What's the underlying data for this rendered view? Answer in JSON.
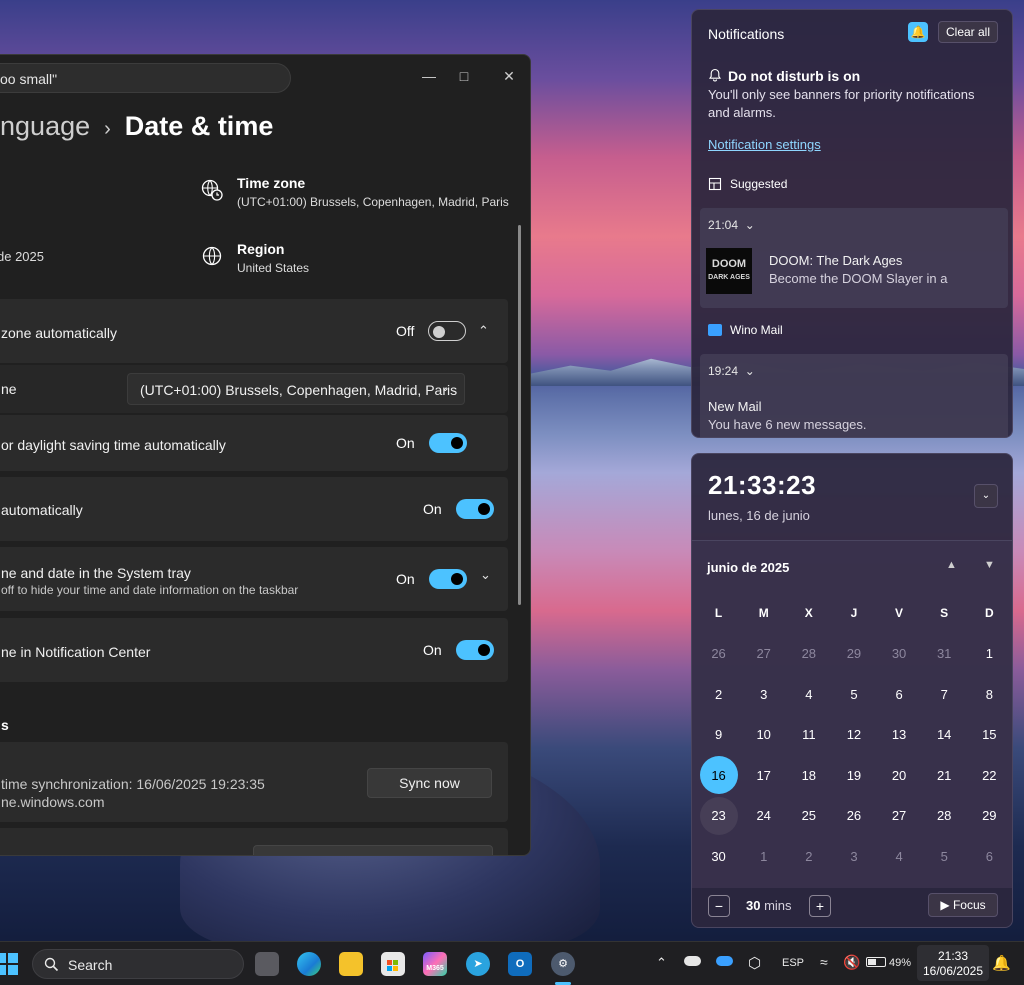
{
  "settings": {
    "search_value": "oo small\"",
    "breadcrumb_parent": "anguage",
    "breadcrumb_sep": "›",
    "breadcrumb_current": "Date & time",
    "date_partial": "de 2025",
    "time_zone": {
      "title": "Time zone",
      "value": "(UTC+01:00) Brussels, Copenhagen, Madrid, Paris"
    },
    "region": {
      "title": "Region",
      "value": "United States"
    },
    "rows": {
      "auto_tz": {
        "label": "zone automatically",
        "state": "Off"
      },
      "tz_select": {
        "label": "ne",
        "value": "(UTC+01:00) Brussels, Copenhagen, Madrid, Paris"
      },
      "dst": {
        "label": "or daylight saving time automatically",
        "state": "On"
      },
      "auto_time": {
        "label": "automatically",
        "state": "On"
      },
      "systray": {
        "label": "ne and date in the System tray",
        "sub": "off to hide your time and date information on the taskbar",
        "state": "On"
      },
      "notif_center": {
        "label": "ne in Notification Center",
        "state": "On"
      }
    },
    "section_heading": "s",
    "sync": {
      "line1": "time synchronization: 16/06/2025 19:23:35",
      "line2": "ne.windows.com",
      "button": "Sync now"
    }
  },
  "notifications": {
    "header": "Notifications",
    "clear_all": "Clear all",
    "dnd_title": "Do not disturb is on",
    "dnd_text": "You'll only see banners for priority notifications and alarms.",
    "settings_link": "Notification settings",
    "groups": [
      {
        "app": "Suggested",
        "time": "21:04",
        "title": "DOOM: The Dark Ages",
        "body": "Become the DOOM Slayer in a",
        "thumb_line1": "DOOM",
        "thumb_line2": "DARK AGES"
      },
      {
        "app": "Wino Mail",
        "time": "19:24",
        "title": "New Mail",
        "body": "You have 6 new messages."
      }
    ]
  },
  "calendar": {
    "clock": "21:33:23",
    "date_long": "lunes, 16 de junio",
    "month_title": "junio de 2025",
    "weekdays": [
      "L",
      "M",
      "X",
      "J",
      "V",
      "S",
      "D"
    ],
    "days": [
      [
        "26",
        "27",
        "28",
        "29",
        "30",
        "31",
        "1"
      ],
      [
        "2",
        "3",
        "4",
        "5",
        "6",
        "7",
        "8"
      ],
      [
        "9",
        "10",
        "11",
        "12",
        "13",
        "14",
        "15"
      ],
      [
        "16",
        "17",
        "18",
        "19",
        "20",
        "21",
        "22"
      ],
      [
        "23",
        "24",
        "25",
        "26",
        "27",
        "28",
        "29"
      ],
      [
        "30",
        "1",
        "2",
        "3",
        "4",
        "5",
        "6"
      ]
    ],
    "focus_minutes": "30",
    "focus_unit": "mins",
    "focus_button": "Focus",
    "accent": "#4cc2ff"
  },
  "taskbar": {
    "search_label": "Search",
    "m365_label": "M365",
    "language": "ESP",
    "battery": "49%",
    "time": "21:33",
    "date": "16/06/2025"
  }
}
